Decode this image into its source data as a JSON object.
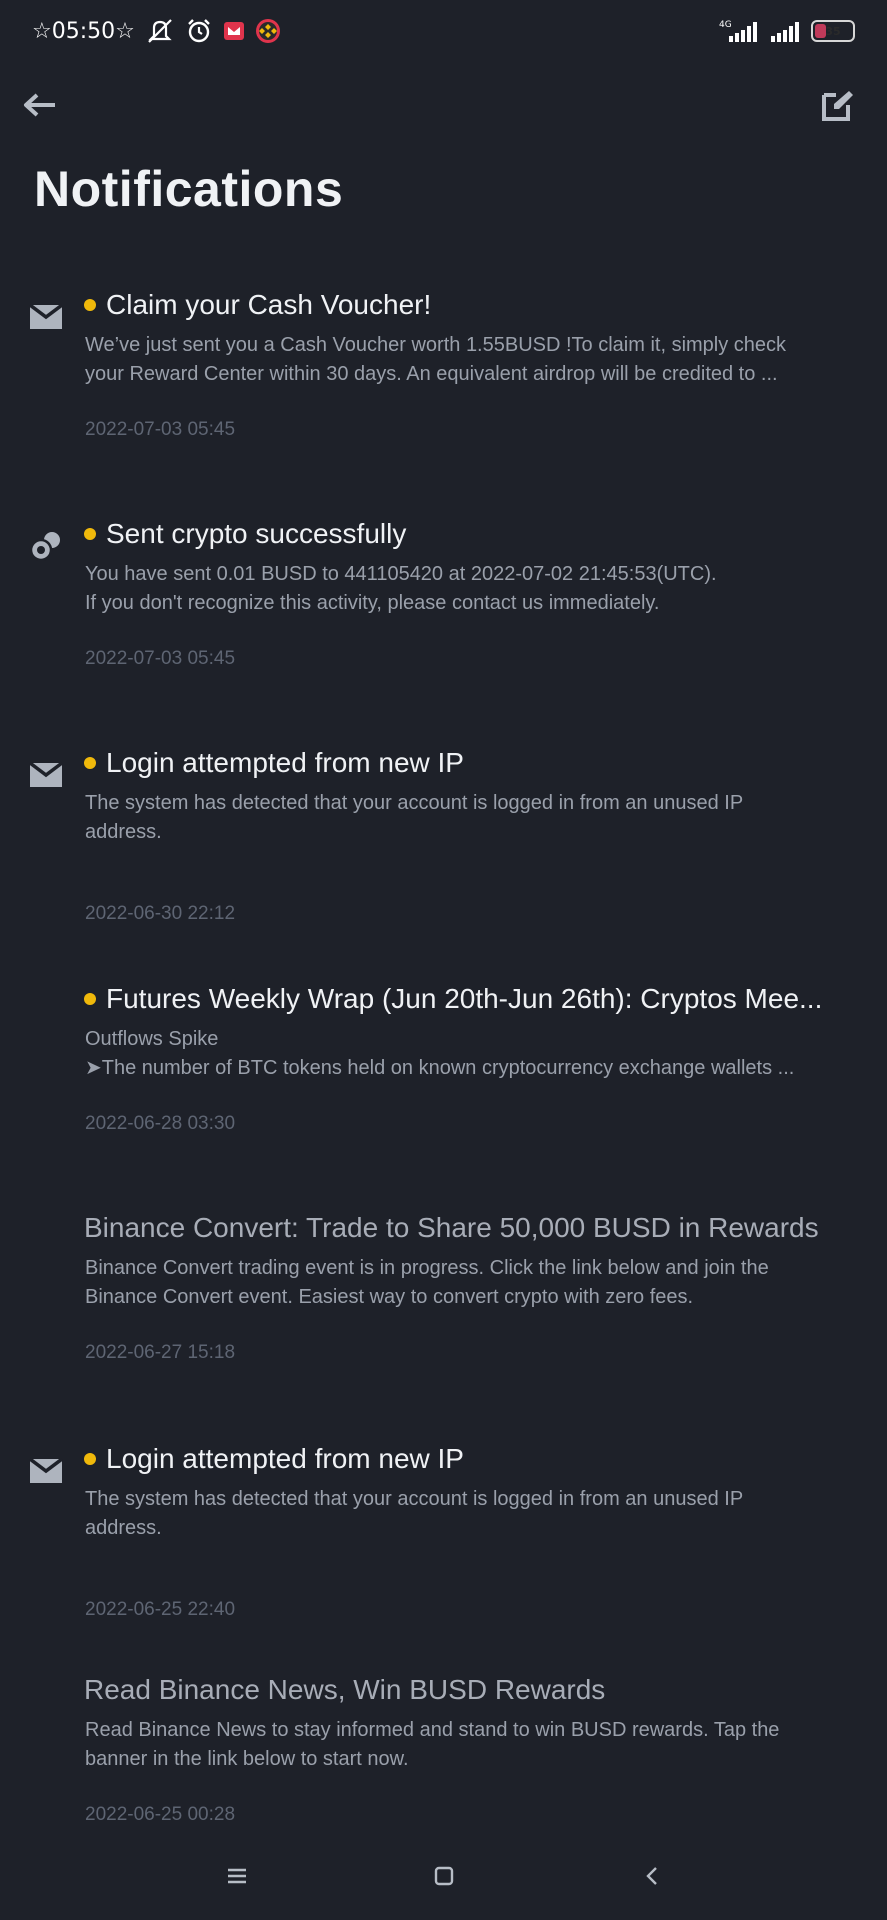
{
  "status_bar": {
    "time": "05:50",
    "network": "4G",
    "battery": "35",
    "battery_level": 0.35,
    "icons": [
      "star-icon",
      "mute-icon",
      "alarm-icon",
      "mail-app-icon",
      "binance-app-icon",
      "signal-icon",
      "wifi-signal-icon",
      "battery-icon"
    ]
  },
  "header": {
    "back_icon": "arrow-left-icon",
    "edit_icon": "mark-all-read-icon",
    "title": "Notifications"
  },
  "colors": {
    "background": "#1e2129",
    "unread_dot": "#f0b90b",
    "title_text": "#f0f2f5",
    "body_text": "#9aa0ab",
    "date_text": "#5e6573"
  },
  "notifications": [
    {
      "icon": "envelope-icon",
      "unread": true,
      "title": "Claim your Cash Voucher!",
      "body_lines": [
        "We’ve just sent you a Cash Voucher worth 1.55BUSD !To claim it, simply check",
        "your Reward Center within 30 days. An equivalent airdrop will be credited to ..."
      ],
      "date": "2022-07-03 05:45"
    },
    {
      "icon": "coins-icon",
      "unread": true,
      "title": "Sent crypto successfully",
      "body_lines": [
        "You have sent 0.01 BUSD to 441105420 at 2022-07-02 21:45:53(UTC).",
        "If you don't recognize this activity, please contact us immediately."
      ],
      "date": "2022-07-03 05:45"
    },
    {
      "icon": "envelope-icon",
      "unread": true,
      "title": "Login attempted from new IP",
      "body_lines": [
        "The system has detected that your account is logged in from an unused IP",
        "address."
      ],
      "date": "2022-06-30 22:12"
    },
    {
      "icon": "",
      "unread": true,
      "title": "Futures Weekly Wrap (Jun 20th-Jun 26th): Cryptos Mee...",
      "body_lines": [
        "Outflows Spike",
        "➤The number of BTC tokens held on known cryptocurrency exchange wallets ..."
      ],
      "date": "2022-06-28 03:30"
    },
    {
      "icon": "",
      "unread": false,
      "title": "Binance Convert: Trade to Share 50,000 BUSD in Rewards",
      "body_lines": [
        "Binance Convert trading event is in progress. Click the link below and join the",
        "Binance Convert event. Easiest way to convert crypto with zero fees."
      ],
      "date": "2022-06-27 15:18"
    },
    {
      "icon": "envelope-icon",
      "unread": true,
      "title": "Login attempted from new IP",
      "body_lines": [
        "The system has detected that your account is logged in from an unused IP",
        "address."
      ],
      "date": "2022-06-25 22:40"
    },
    {
      "icon": "",
      "unread": false,
      "title": "Read Binance News, Win BUSD Rewards",
      "body_lines": [
        "Read Binance News to stay informed and stand to win BUSD rewards. Tap the",
        "banner in the link below to start now."
      ],
      "date": "2022-06-25 00:28"
    }
  ],
  "nav_bar": {
    "icons": [
      "menu-icon",
      "home-square-icon",
      "back-chevron-icon"
    ]
  }
}
